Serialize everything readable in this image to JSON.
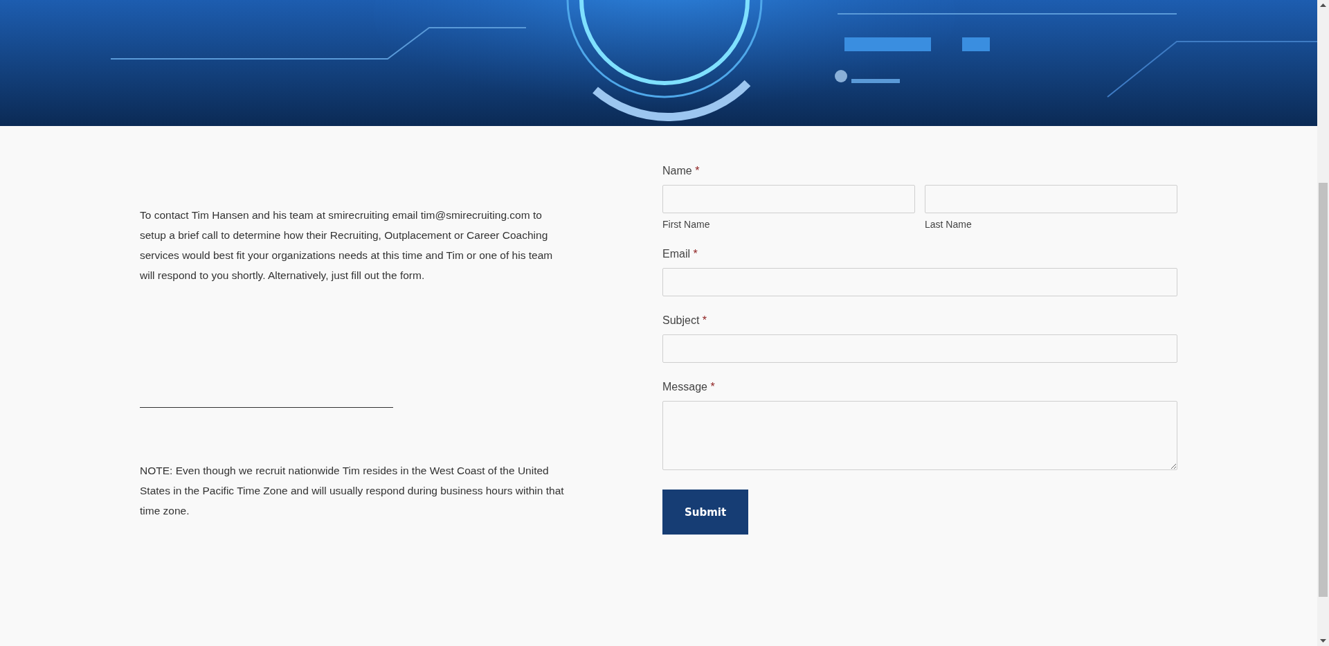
{
  "intro": {
    "text": "To contact Tim Hansen and his team at smirecruiting email tim@smirecruiting.com to setup a brief call to determine how their Recruiting, Outplacement or Career Coaching services would best fit your organizations needs at this time and Tim or one of his team will respond to you shortly. Alternatively, just fill out the form."
  },
  "note": {
    "text": "NOTE: Even though we recruit nationwide Tim resides in the West Coast of the United States in the Pacific Time Zone and will usually respond during business hours within that time zone."
  },
  "form": {
    "fields": [
      {
        "kind": "name",
        "label": "Name",
        "required_mark": "*",
        "sublabels": [
          "First Name",
          "Last Name"
        ]
      },
      {
        "kind": "text",
        "label": "Email",
        "required_mark": "*"
      },
      {
        "kind": "text",
        "label": "Subject",
        "required_mark": "*"
      },
      {
        "kind": "textarea",
        "label": "Message",
        "required_mark": "*"
      }
    ],
    "submit": "Submit"
  }
}
